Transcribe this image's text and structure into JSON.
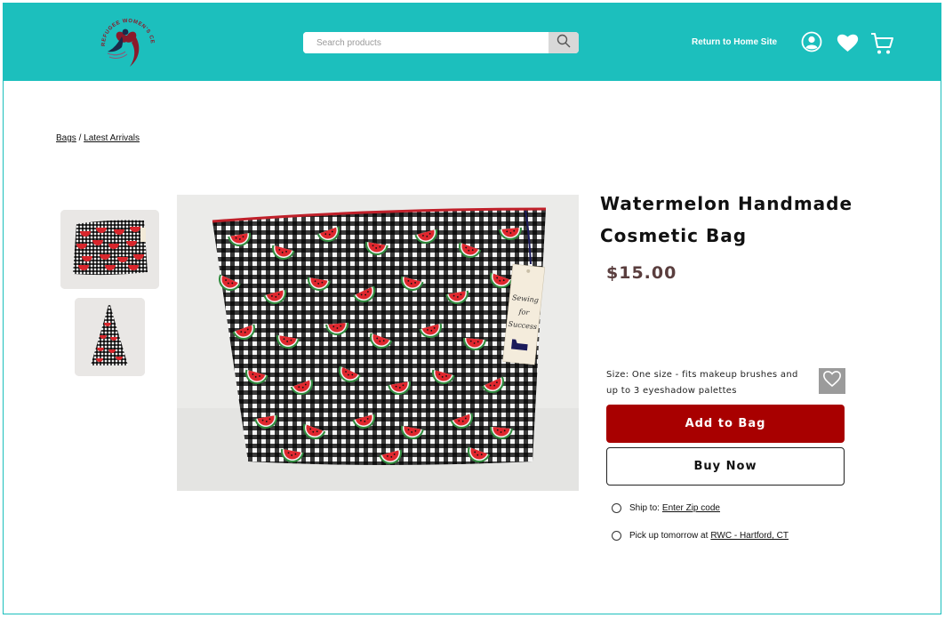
{
  "header": {
    "logo_text": "REFUGEE WOMEN'S CENTER",
    "search_placeholder": "Search products",
    "return_link": "Return to Home Site",
    "icons": [
      "search-icon",
      "account-icon",
      "heart-icon",
      "cart-icon"
    ],
    "background": "#1cbfbd"
  },
  "breadcrumb": {
    "items": [
      {
        "label": "Bags"
      },
      {
        "label": "Latest Arrivals"
      }
    ],
    "separator": "/"
  },
  "product": {
    "title": "Watermelon Handmade Cosmetic Bag",
    "price": "$15.00",
    "size_text": "Size: One size - fits makeup brushes and up to 3 eyeshadow palettes",
    "add_to_bag_label": "Add to Bag",
    "buy_now_label": "Buy Now",
    "tag_text": "Sewing for Success",
    "accent_color": "#a80000"
  },
  "fulfillment": {
    "ship_label": "Ship to:",
    "ship_link": "Enter Zip code",
    "pickup_label": "Pick up tomorrow at",
    "pickup_link": "RWC - Hartford, CT"
  }
}
